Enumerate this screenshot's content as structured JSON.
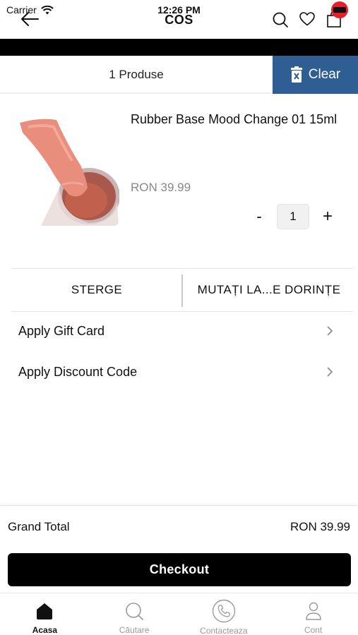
{
  "status_bar": {
    "carrier": "Carrier",
    "time": "12:26 PM"
  },
  "nav": {
    "title": "COS"
  },
  "cart_header": {
    "count_label": "1 Produse",
    "clear_label": "Clear"
  },
  "item": {
    "name": "Rubber Base Mood Change 01 15ml",
    "price": "RON 39.99",
    "quantity": "1",
    "qty_minus": "-",
    "qty_plus": "+",
    "image_icon": "nail-gel-product-image"
  },
  "item_actions": {
    "delete_label": "STERGE",
    "move_label": "MUTAȚI LA...E DORINȚE"
  },
  "apply": {
    "gift_card": "Apply Gift Card",
    "discount_code": "Apply Discount Code"
  },
  "summary": {
    "grand_total_label": "Grand Total",
    "grand_total_value": "RON 39.99",
    "checkout_label": "Checkout"
  },
  "tabs": [
    {
      "label": "Acasa",
      "icon": "home-icon",
      "active": true
    },
    {
      "label": "Căutare",
      "icon": "search-icon",
      "active": false
    },
    {
      "label": "Contacteaza",
      "icon": "phone-icon",
      "active": false
    },
    {
      "label": "Cont",
      "icon": "user-icon",
      "active": false
    }
  ],
  "colors": {
    "clear_button": "#2e5e93",
    "checkout_button": "#000000",
    "cart_badge": "#e5202c"
  }
}
